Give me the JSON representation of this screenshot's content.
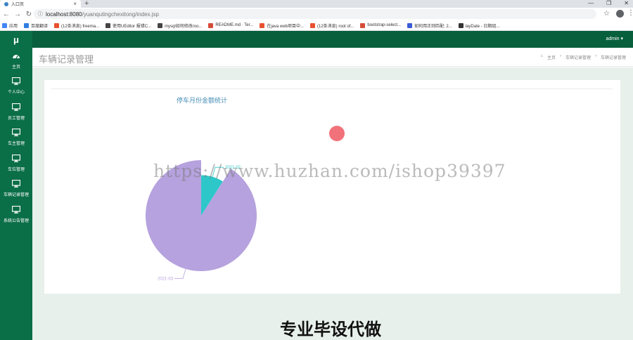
{
  "browser": {
    "tab_title": "入口页",
    "url_host": "localhost:8080",
    "url_path": "/yuanqutingchexitong/index.jsp",
    "bookmarks": [
      {
        "label": "应用",
        "color": "#4285f4"
      },
      {
        "label": "百度翻译",
        "color": "#2f7de1"
      },
      {
        "label": "(12条消息) freema...",
        "color": "#e8512f"
      },
      {
        "label": "使用UEditor 报错C...",
        "color": "#444444"
      },
      {
        "label": "mysql如何修改roo...",
        "color": "#444444"
      },
      {
        "label": "README.md · Ter...",
        "color": "#d44c3a"
      },
      {
        "label": "在java web项目中...",
        "color": "#e8512f"
      },
      {
        "label": "(12条消息) root of...",
        "color": "#e8512f"
      },
      {
        "label": "bootstrap-select...",
        "color": "#d44c3a"
      },
      {
        "label": "如何用正则匹配: 2...",
        "color": "#3a5bd4"
      },
      {
        "label": "layDate - 日期组...",
        "color": "#333333"
      }
    ]
  },
  "app": {
    "logo": "μ",
    "user": "admin ▾",
    "nav": [
      {
        "label": "主页",
        "icon": "dashboard-icon"
      },
      {
        "label": "个人中心",
        "icon": "monitor-icon"
      },
      {
        "label": "员工管理",
        "icon": "monitor-icon"
      },
      {
        "label": "车主管理",
        "icon": "monitor-icon"
      },
      {
        "label": "车位管理",
        "icon": "monitor-icon"
      },
      {
        "label": "车辆记录管理",
        "icon": "monitor-icon"
      },
      {
        "label": "系统公告管理",
        "icon": "monitor-icon"
      }
    ],
    "page_title": "车辆记录管理",
    "breadcrumb": [
      "主页",
      "车辆记录管理",
      "车辆记录管理"
    ]
  },
  "chart_data": {
    "type": "pie",
    "title": "停车月份金额统计",
    "labels": [
      "2021-02",
      "2021-03"
    ],
    "values": [
      9,
      91
    ],
    "colors": [
      "#2ec7c9",
      "#b6a2de"
    ],
    "rose_type": "radius",
    "radius_ratios": [
      0.73,
      1.0
    ]
  },
  "overlay": {
    "watermark": "https://www.huzhan.com/ishop39397",
    "banner": "专业毕设代做"
  }
}
